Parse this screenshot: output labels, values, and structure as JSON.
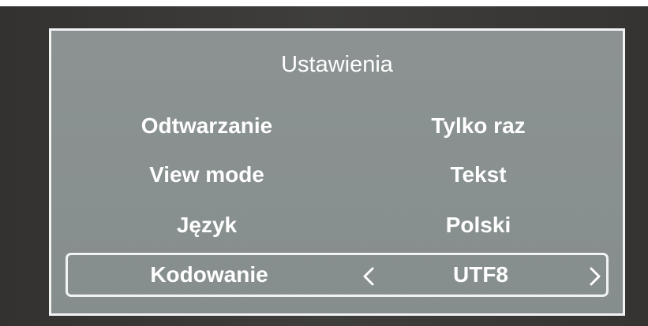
{
  "settings_menu": {
    "title": "Ustawienia",
    "items": [
      {
        "label": "Odtwarzanie",
        "value": "Tylko raz"
      },
      {
        "label": "View mode",
        "value": "Tekst"
      },
      {
        "label": "Język",
        "value": "Polski"
      },
      {
        "label": "Kodowanie",
        "value": "UTF8"
      }
    ],
    "selected_index": 3
  },
  "colors": {
    "panel_background": "#8a9090",
    "panel_border": "#f2f4f4",
    "text": "#ffffff",
    "screen_background": "#3a3836"
  },
  "icons": {
    "prev": "chevron-left-icon",
    "next": "chevron-right-icon"
  }
}
